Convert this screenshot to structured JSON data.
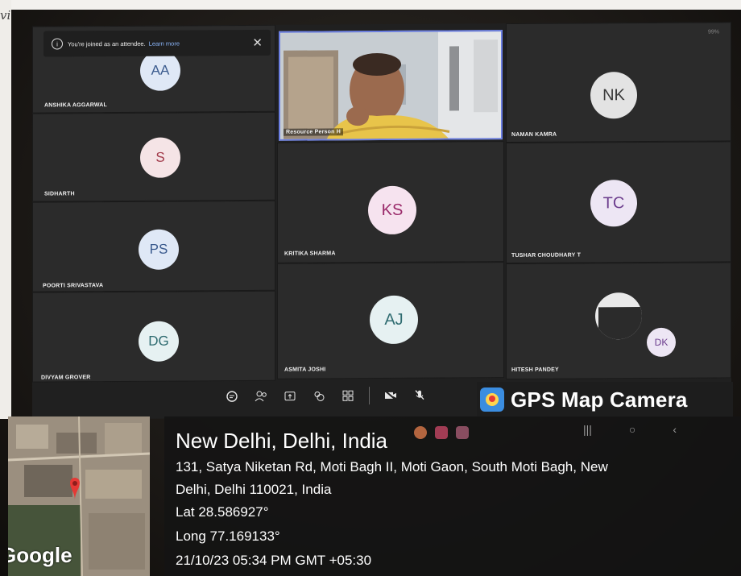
{
  "corner_glyph": "vi",
  "toast": {
    "message": "You're joined as an attendee.",
    "link": "Learn more"
  },
  "battery": "99%",
  "video_tile": {
    "name": "Resource Person H"
  },
  "participants": [
    {
      "initials": "AA",
      "name": "ANSHIKA AGGARWAL"
    },
    {
      "initials": "S",
      "name": "SIDHARTH"
    },
    {
      "initials": "PS",
      "name": "POORTI  SRIVASTAVA"
    },
    {
      "initials": "DG",
      "name": "DIVYAM GROVER"
    },
    {
      "initials": "KS",
      "name": "KRITIKA SHARMA"
    },
    {
      "initials": "AJ",
      "name": "ASMITA JOSHI"
    },
    {
      "initials": "NK",
      "name": "NAMAN KAMRA"
    },
    {
      "initials": "TC",
      "name": "TUSHAR CHOUDHARY T"
    },
    {
      "initials": "DK",
      "name": "HITESH PANDEY"
    }
  ],
  "toolbar_icons": [
    "chat-icon",
    "people-icon",
    "share-icon",
    "reactions-icon",
    "view-icon",
    "camera-off-icon",
    "mic-off-icon"
  ],
  "nav_icons": [
    "recents-icon",
    "home-icon",
    "back-icon"
  ],
  "gps": {
    "brand": "GPS Map Camera",
    "city": "New Delhi, Delhi, India",
    "address_line1": "131, Satya Niketan Rd, Moti Bagh II, Moti Gaon, South Moti Bagh, New",
    "address_line2": "Delhi, Delhi 110021, India",
    "lat": "Lat 28.586927°",
    "long": "Long 77.169133°",
    "datetime": "21/10/23 05:34 PM GMT +05:30",
    "map_label": "Google"
  },
  "colors": {
    "accent": "#6a7de0",
    "pin": "#e53935"
  }
}
